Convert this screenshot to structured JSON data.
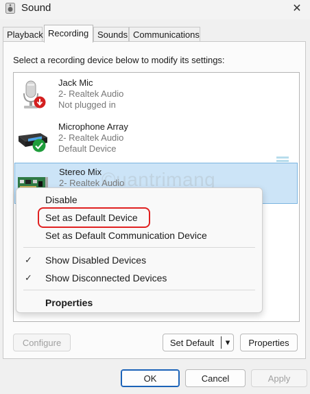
{
  "window": {
    "title": "Sound",
    "close_glyph": "✕"
  },
  "tabs": [
    {
      "label": "Playback"
    },
    {
      "label": "Recording"
    },
    {
      "label": "Sounds"
    },
    {
      "label": "Communications"
    }
  ],
  "active_tab": "Recording",
  "instruction": "Select a recording device below to modify its settings:",
  "devices": [
    {
      "name": "Jack Mic",
      "line1": "2- Realtek Audio",
      "line2": "Not plugged in",
      "icon": "microphone-icon",
      "status_icon": "unplugged-arrow-icon"
    },
    {
      "name": "Microphone Array",
      "line1": "2- Realtek Audio",
      "line2": "Default Device",
      "icon": "microphone-array-icon",
      "status_icon": "default-check-icon"
    },
    {
      "name": "Stereo Mix",
      "line1": "2- Realtek Audio",
      "icon": "sound-card-icon",
      "selected": true
    }
  ],
  "watermark": "©uantrimang",
  "context_menu": {
    "items": [
      {
        "label": "Disable"
      },
      {
        "label": "Set as Default Device",
        "highlighted": true
      },
      {
        "label": "Set as Default Communication Device"
      },
      {
        "label": "Show Disabled Devices",
        "checked": true
      },
      {
        "label": "Show Disconnected Devices",
        "checked": true
      },
      {
        "label": "Properties",
        "bold": true
      }
    ],
    "check_glyph": "✓"
  },
  "buttons": {
    "configure": "Configure",
    "set_default": "Set Default",
    "split_arrow": "▾",
    "properties": "Properties",
    "ok": "OK",
    "cancel": "Cancel",
    "apply": "Apply"
  },
  "colors": {
    "selected_row": "#cce4f7",
    "default_check": "#1f9d3b",
    "unplugged": "#d42020",
    "highlight_ring": "#e02020",
    "primary_border": "#1a62b8"
  }
}
